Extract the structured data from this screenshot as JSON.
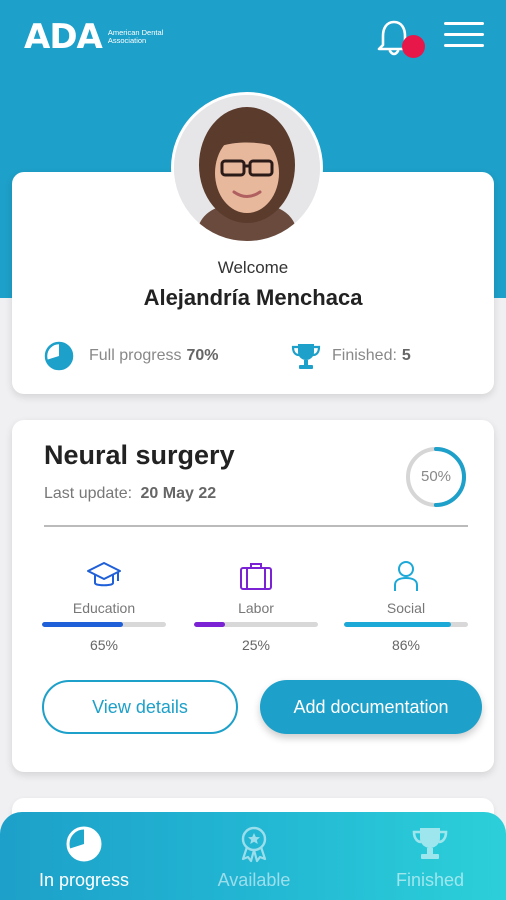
{
  "brand": {
    "logo_text": "ADA",
    "logo_subtitle": "American Dental Association"
  },
  "header": {
    "notifications_icon": "bell-icon",
    "menu_icon": "hamburger-menu-icon"
  },
  "profile": {
    "welcome": "Welcome",
    "name": "Alejandría Menchaca",
    "progress_label": "Full progress",
    "progress_value": "70%",
    "finished_label": "Finished:",
    "finished_value": "5"
  },
  "course": {
    "title": "Neural surgery",
    "last_update_label": "Last update:",
    "last_update_value": "20 May 22",
    "progress_percent": 50,
    "progress_label": "50%",
    "categories": [
      {
        "label": "Education",
        "percent": 65,
        "percent_label": "65%",
        "color": "#1f5fd8",
        "icon": "graduation-cap-icon"
      },
      {
        "label": "Labor",
        "percent": 25,
        "percent_label": "25%",
        "color": "#7a22d4",
        "icon": "briefcase-icon"
      },
      {
        "label": "Social",
        "percent": 86,
        "percent_label": "86%",
        "color": "#1da9d8",
        "icon": "person-icon"
      }
    ],
    "view_details": "View details",
    "add_documentation": "Add documentation"
  },
  "bottom_nav": [
    {
      "label": "In progress",
      "icon": "pie-progress-icon",
      "active": true
    },
    {
      "label": "Available",
      "icon": "award-badge-icon",
      "active": false
    },
    {
      "label": "Finished",
      "icon": "trophy-icon",
      "active": false
    }
  ],
  "colors": {
    "primary": "#1da0c9",
    "notification_dot": "#e8174a"
  }
}
